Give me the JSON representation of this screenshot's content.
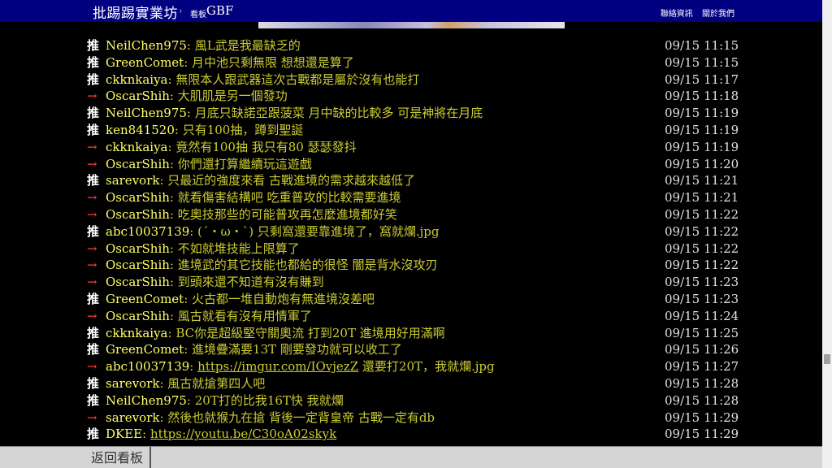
{
  "header": {
    "site_title": "批踢踢實業坊",
    "breadcrumb_separator": "›",
    "board_label": "看板",
    "board_name": "GBF",
    "links": [
      "聯絡資訊",
      "關於我們"
    ]
  },
  "footer": {
    "back_label": "返回看板"
  },
  "pushes": [
    {
      "tag": "推",
      "user": "NeilChen975",
      "content": ": 風L武是我最缺乏的",
      "time": "09/15 11:15"
    },
    {
      "tag": "推",
      "user": "GreenComet",
      "content": ": 月中池只剩無限  想想還是算了",
      "time": "09/15 11:15"
    },
    {
      "tag": "推",
      "user": "ckknkaiya",
      "content": ": 無限本人跟武器這次古戰都是屬於沒有也能打",
      "time": "09/15 11:17"
    },
    {
      "tag": "→",
      "user": "OscarShih",
      "content": ": 大肌肌是另一個發功",
      "time": "09/15 11:18"
    },
    {
      "tag": "推",
      "user": "NeilChen975",
      "content": ": 月底只缺諾亞跟菠菜 月中缺的比較多 可是神將在月底",
      "time": "09/15 11:19"
    },
    {
      "tag": "推",
      "user": "ken841520",
      "content": ": 只有100抽，蹲到聖誕",
      "time": "09/15 11:19"
    },
    {
      "tag": "→",
      "user": "ckknkaiya",
      "content": ": 竟然有100抽 我只有80 瑟瑟發抖",
      "time": "09/15 11:19"
    },
    {
      "tag": "→",
      "user": "OscarShih",
      "content": ": 你們還打算繼續玩這遊戲",
      "time": "09/15 11:20"
    },
    {
      "tag": "推",
      "user": "sarevork",
      "content": ": 只最近的強度來看 古戰進境的需求越來越低了",
      "time": "09/15 11:21"
    },
    {
      "tag": "→",
      "user": "OscarShih",
      "content": ": 就看傷害結構吧 吃重普攻的比較需要進境",
      "time": "09/15 11:21"
    },
    {
      "tag": "→",
      "user": "OscarShih",
      "content": ": 吃奧技那些的可能普攻再怎麼進境都好笑",
      "time": "09/15 11:22"
    },
    {
      "tag": "推",
      "user": "abc10037139",
      "content": ": (´・ω・`) 只剩窩還要靠進境了，窩就爛.jpg",
      "time": "09/15 11:22"
    },
    {
      "tag": "→",
      "user": "OscarShih",
      "content": ": 不如就堆技能上限算了",
      "time": "09/15 11:22"
    },
    {
      "tag": "→",
      "user": "OscarShih",
      "content": ": 進境武的其它技能也都給的很怪 闇是背水沒攻刃",
      "time": "09/15 11:22"
    },
    {
      "tag": "→",
      "user": "OscarShih",
      "content": ": 到頭來還不知道有沒有賺到",
      "time": "09/15 11:23"
    },
    {
      "tag": "推",
      "user": "GreenComet",
      "content": ": 火古都一堆自動炮有無進境沒差吧",
      "time": "09/15 11:23"
    },
    {
      "tag": "→",
      "user": "OscarShih",
      "content": ": 風古就看有沒有用情軍了",
      "time": "09/15 11:24"
    },
    {
      "tag": "推",
      "user": "ckknkaiya",
      "content": ": BC你是超級堅守關奧流 打到20T 進境用好用滿啊",
      "time": "09/15 11:25"
    },
    {
      "tag": "推",
      "user": "GreenComet",
      "content": ": 進境疊滿要13T  剛要發功就可以收工了",
      "time": "09/15 11:26"
    },
    {
      "tag": "→",
      "user": "abc10037139",
      "content_prefix": ": ",
      "link": "https://imgur.com/IOvjezZ",
      "content_suffix": " 還要打20T，我就爛.jpg",
      "time": "09/15 11:27"
    },
    {
      "tag": "推",
      "user": "sarevork",
      "content": ": 風古就搶第四人吧",
      "time": "09/15 11:28"
    },
    {
      "tag": "推",
      "user": "NeilChen975",
      "content": ": 20T打的比我16T快 我就爛",
      "time": "09/15 11:28"
    },
    {
      "tag": "→",
      "user": "sarevork",
      "content": ": 然後也就猴九在搶 背後一定背皇帝 古戰一定有db",
      "time": "09/15 11:29"
    },
    {
      "tag": "推",
      "user": "DKEE",
      "content_prefix": ": ",
      "link": "https://youtu.be/C30oA02skyk",
      "content_suffix": "",
      "time": "09/15 11:29"
    }
  ]
}
